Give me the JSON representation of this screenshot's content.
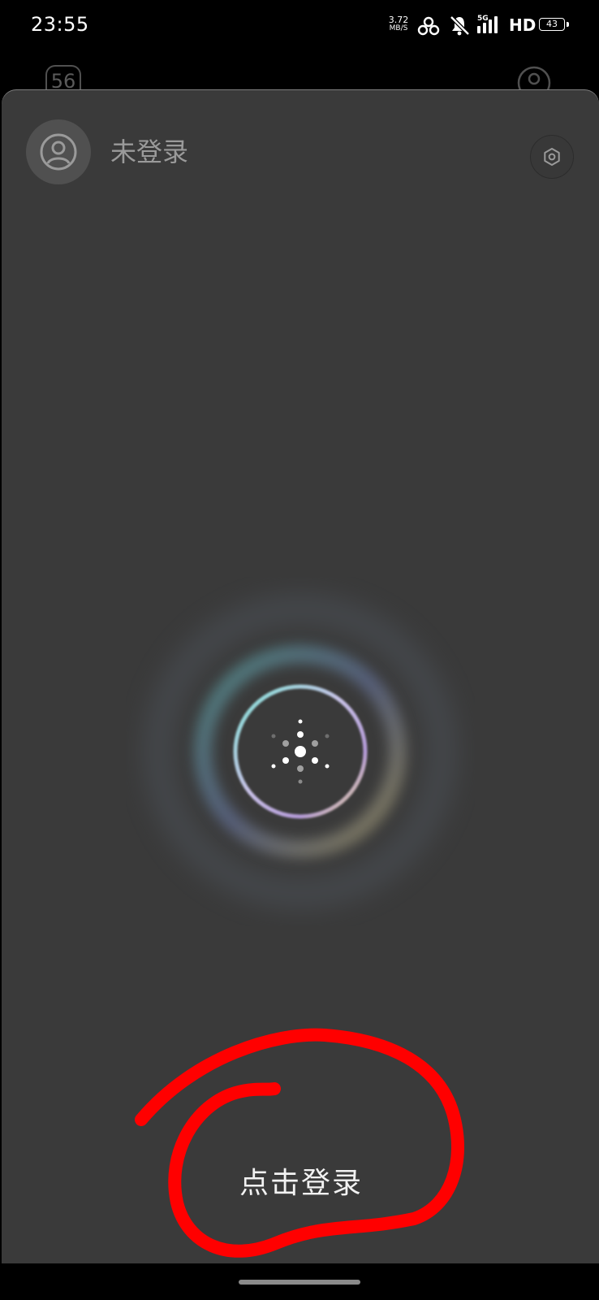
{
  "status_bar": {
    "time": "23:55",
    "network_speed_value": "3.72",
    "network_speed_unit": "MB/S",
    "network_type": "5G",
    "hd_label": "HD",
    "battery_level": "43",
    "icons": [
      "hotspot-icon",
      "mute-icon",
      "signal-icon",
      "battery-icon"
    ]
  },
  "background": {
    "badge_value": "56"
  },
  "header": {
    "login_status": "未登录",
    "avatar_icon": "user-icon",
    "settings_icon": "settings-icon"
  },
  "main": {
    "assistant_icon": "assistant-orb-icon",
    "login_button_label": "点击登录"
  },
  "colors": {
    "sheet_background": "#3a3a3a",
    "annotation_red": "#ff0000",
    "text_muted": "#9a9a9a",
    "text_primary": "#f2f2f2"
  }
}
